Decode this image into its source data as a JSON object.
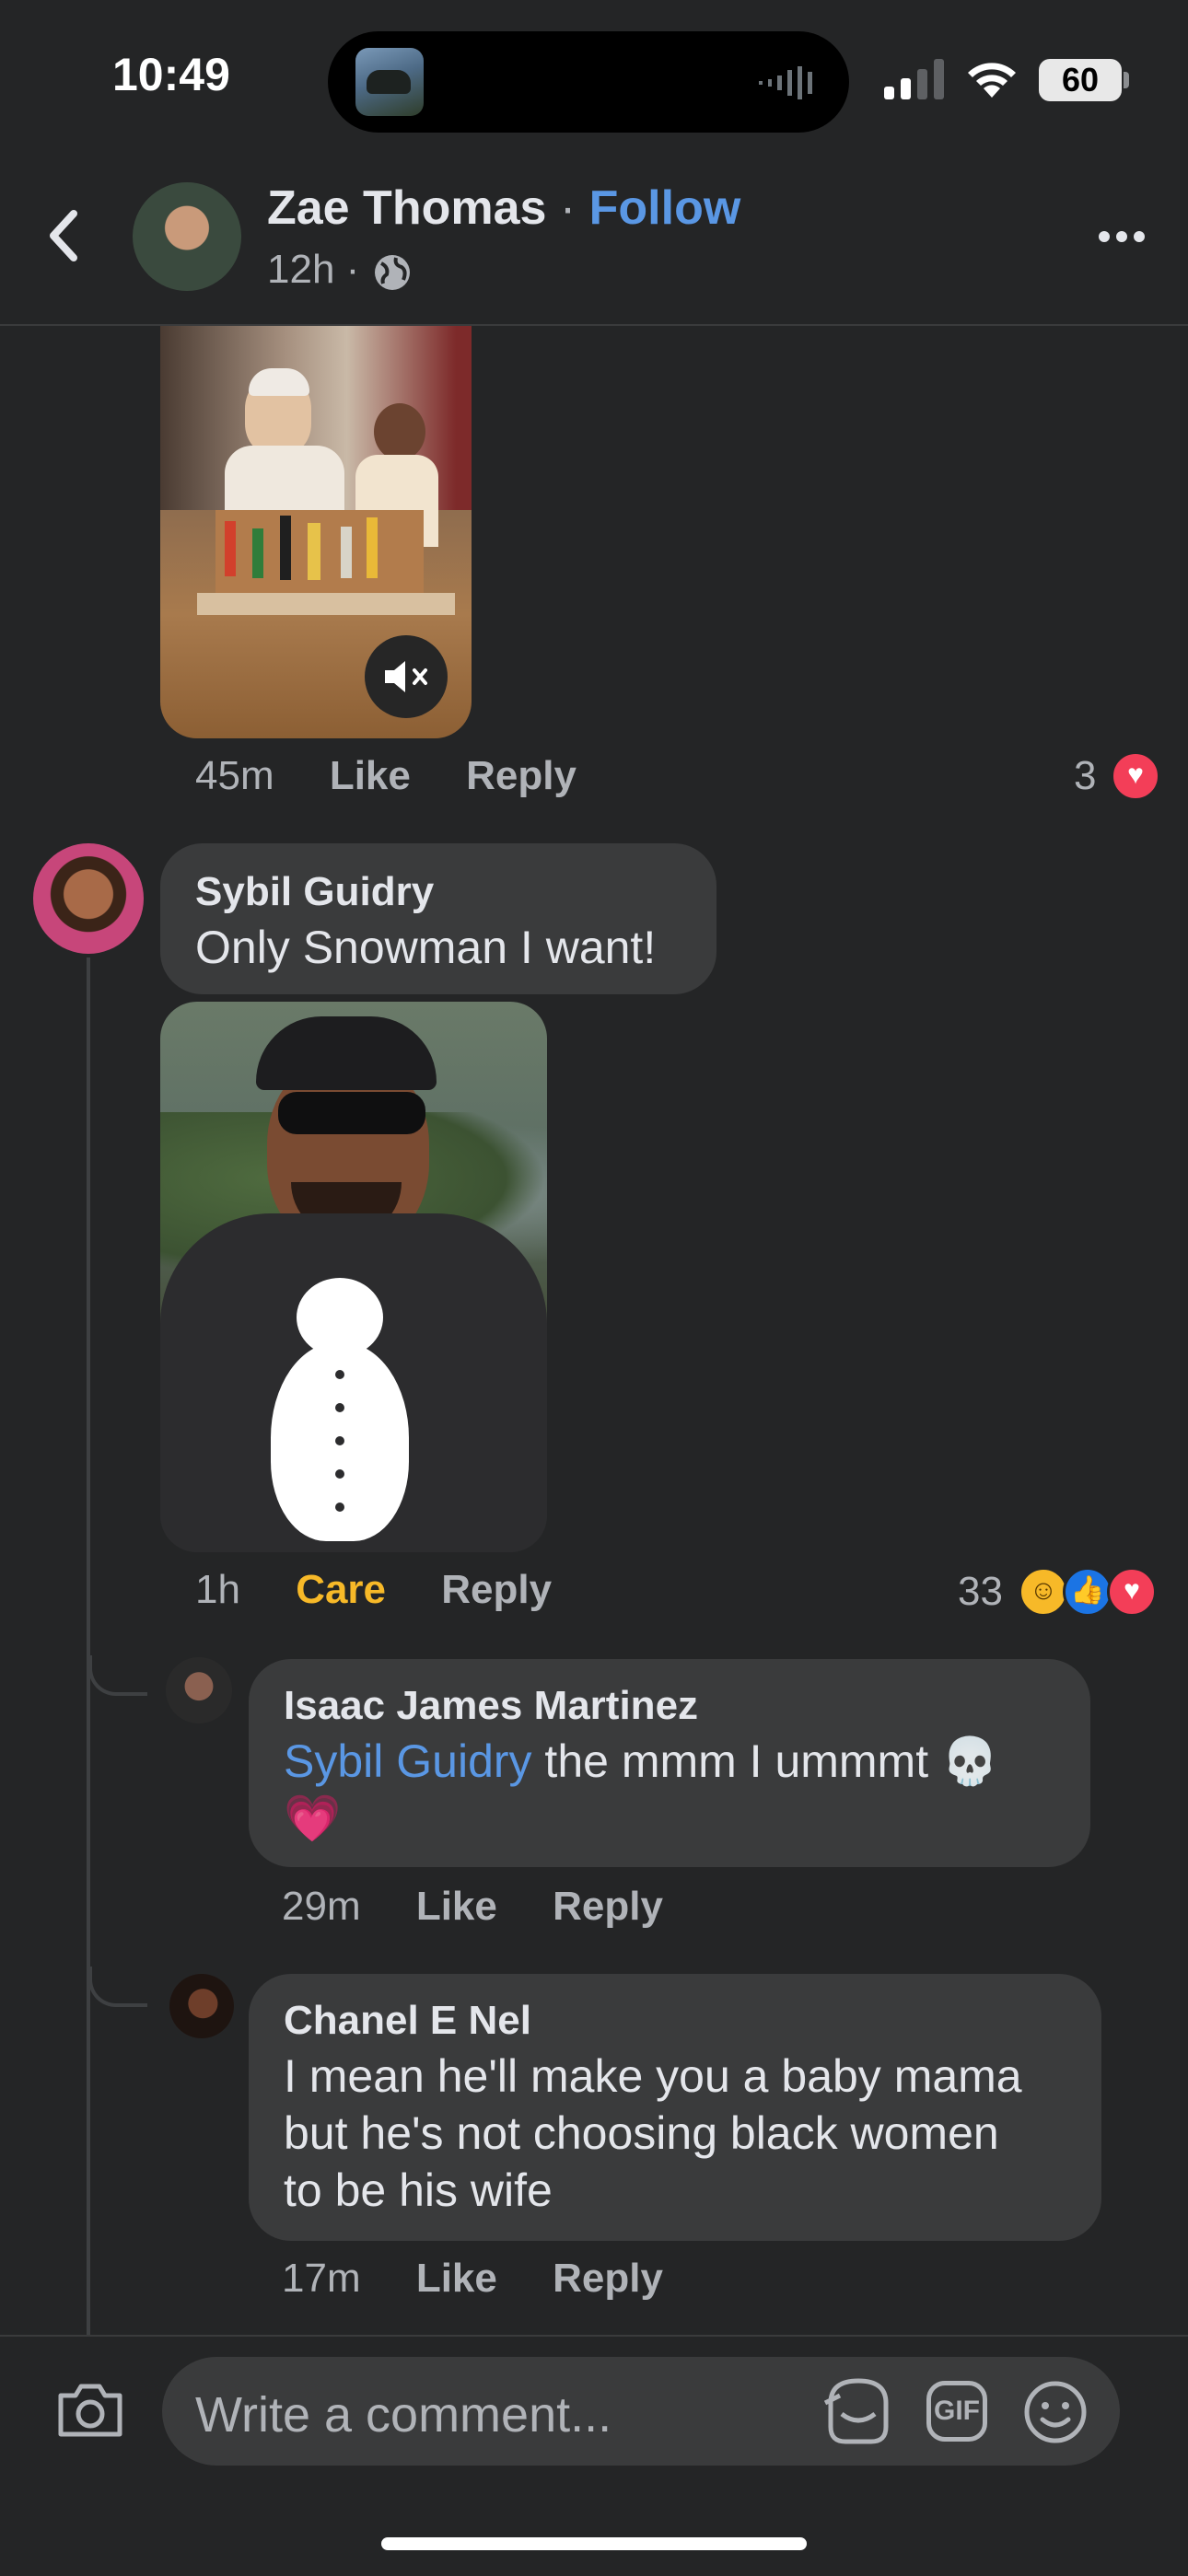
{
  "status_bar": {
    "time": "10:49",
    "battery": "60"
  },
  "post_header": {
    "author": "Zae Thomas",
    "follow_label": "Follow",
    "timestamp": "12h"
  },
  "comments": {
    "top": {
      "time": "45m",
      "like": "Like",
      "reply": "Reply",
      "reaction_count": "3"
    },
    "sybil": {
      "author": "Sybil Guidry",
      "text": "Only Snowman I want!",
      "time": "1h",
      "reaction_label": "Care",
      "reply": "Reply",
      "reaction_count": "33"
    },
    "isaac": {
      "author": "Isaac James Martinez",
      "mention": "Sybil Guidry",
      "text": " the mmm I ummmt 💀",
      "text2": "💗",
      "time": "29m",
      "like": "Like",
      "reply": "Reply"
    },
    "chanel": {
      "author": "Chanel E Nel",
      "line1": "I mean he'll make you a baby mama",
      "line2": "but he's not choosing black women",
      "line3": "to be his wife",
      "time": "17m",
      "like": "Like",
      "reply": "Reply"
    }
  },
  "composer": {
    "placeholder": "Write a comment...",
    "gif_label": "GIF"
  },
  "colors": {
    "background": "#242526",
    "bubble": "#3a3b3c",
    "link": "#5a97e4",
    "care": "#f7b928"
  }
}
